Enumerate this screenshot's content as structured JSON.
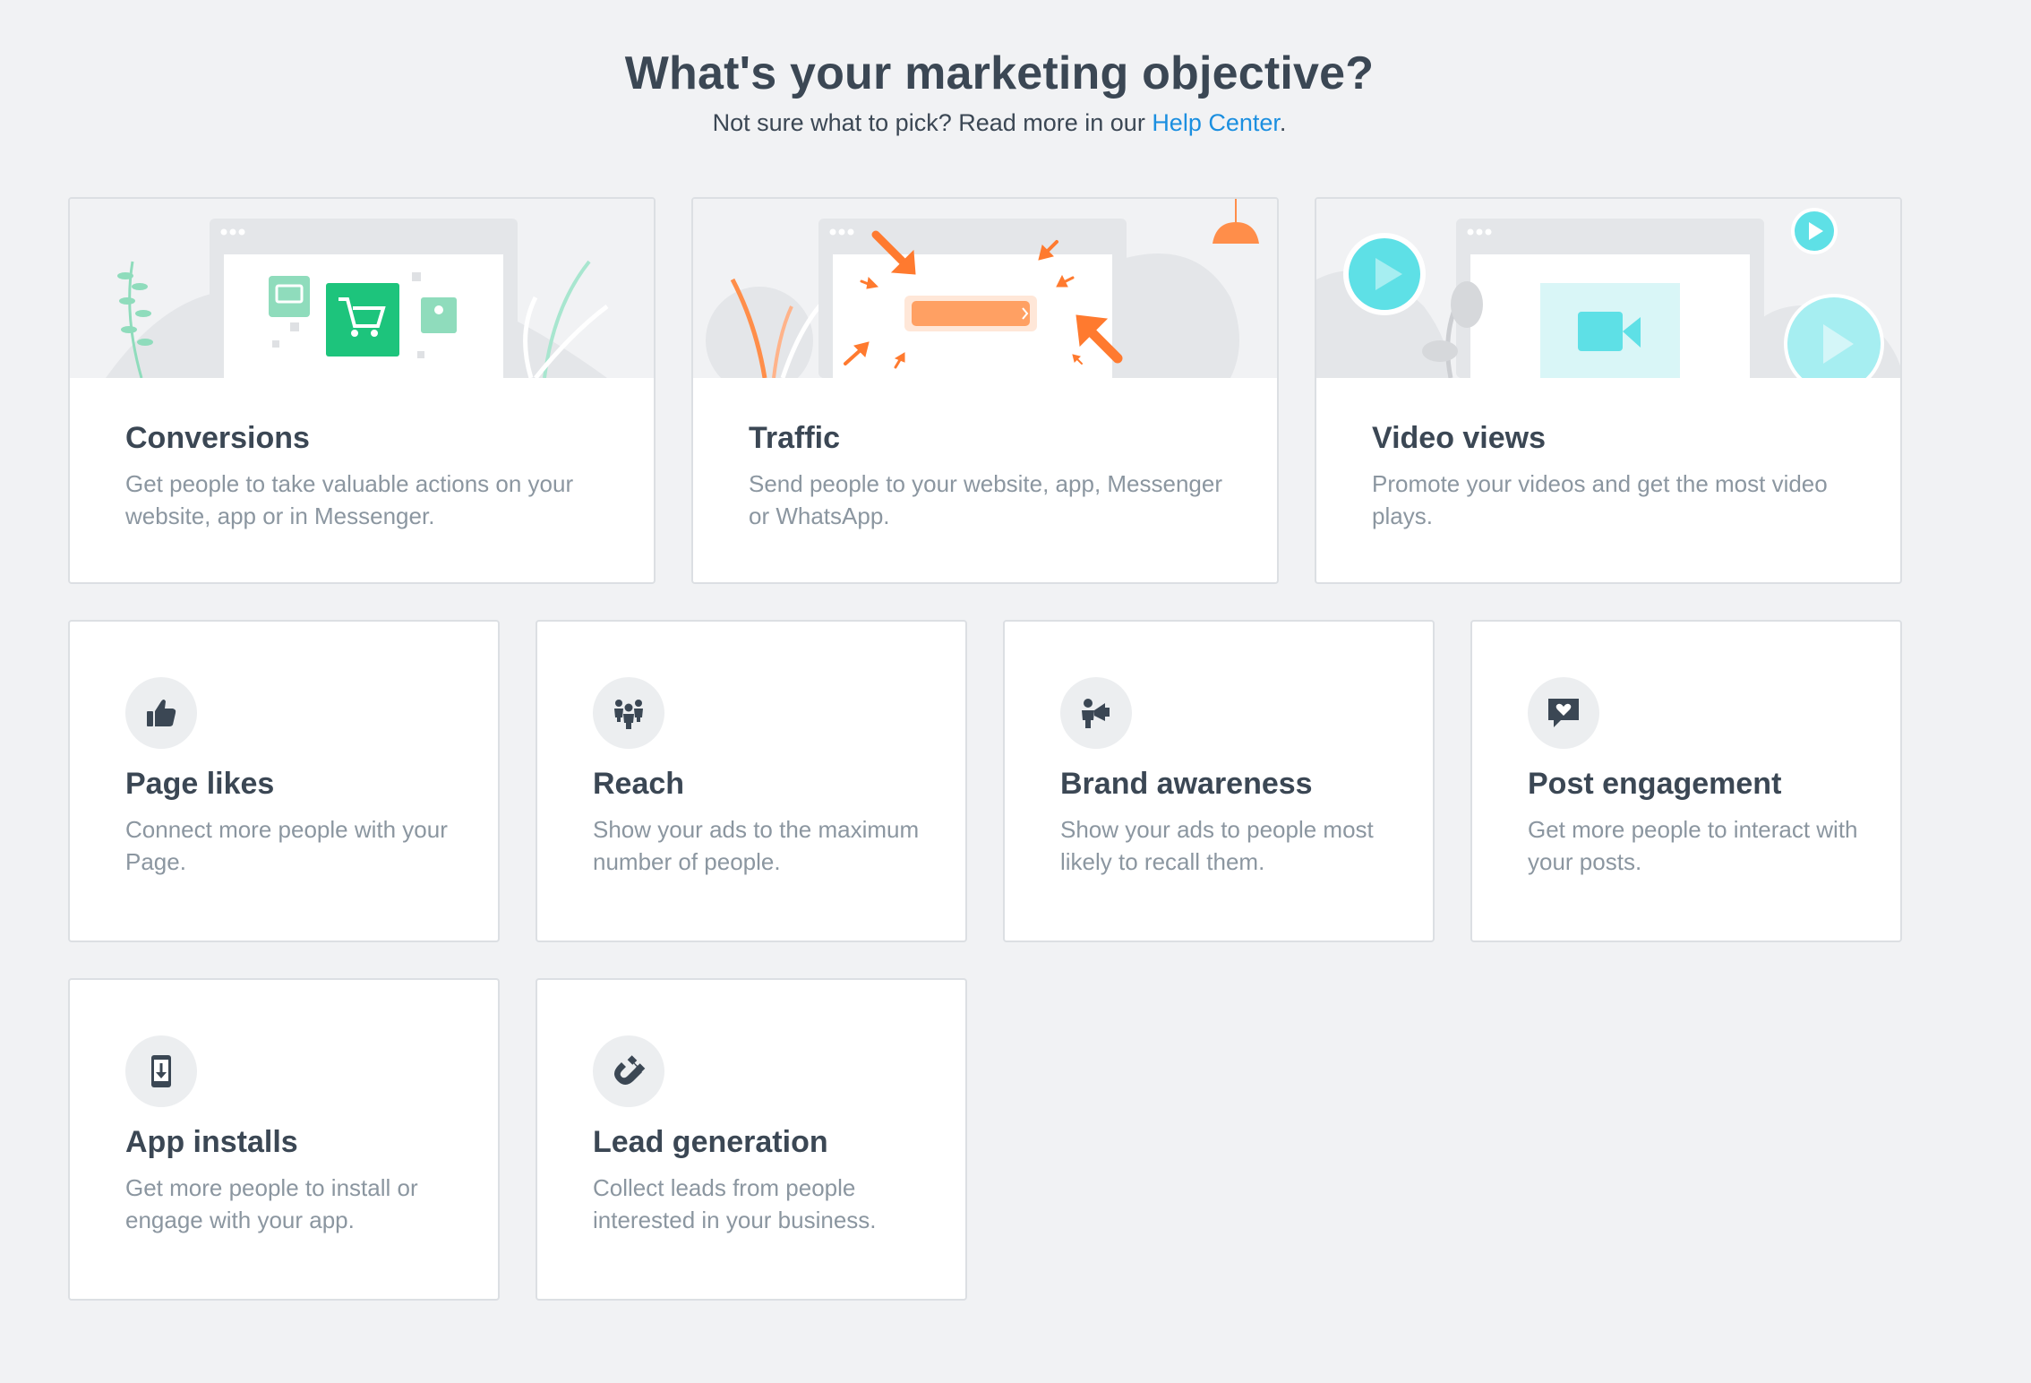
{
  "header": {
    "title": "What's your marketing objective?",
    "subtitle_prefix": "Not sure what to pick? Read more in our ",
    "help_link": "Help Center",
    "subtitle_suffix": "."
  },
  "colors": {
    "page_bg": "#f1f2f4",
    "text_dark": "#3b4754",
    "text_muted": "#8b96a0",
    "link": "#1b8fe0",
    "green": "#1dc47c",
    "orange": "#ff7a2f",
    "cyan": "#5ee0e6"
  },
  "objectives": {
    "conversions": {
      "title": "Conversions",
      "desc": "Get people to take valuable actions on your website, app or in Messenger.",
      "icon": "shopping-cart-illustration"
    },
    "traffic": {
      "title": "Traffic",
      "desc": "Send people to your website, app, Messenger or WhatsApp.",
      "icon": "arrows-to-button-illustration"
    },
    "video_views": {
      "title": "Video views",
      "desc": "Promote your videos and get the most video plays.",
      "icon": "video-play-illustration"
    },
    "page_likes": {
      "title": "Page likes",
      "desc": "Connect more people with your Page.",
      "icon": "thumbs-up-icon"
    },
    "reach": {
      "title": "Reach",
      "desc": "Show your ads to the maximum number of people.",
      "icon": "people-group-icon"
    },
    "brand_awareness": {
      "title": "Brand awareness",
      "desc": "Show your ads to people most likely to recall them.",
      "icon": "person-megaphone-icon"
    },
    "post_engagement": {
      "title": "Post engagement",
      "desc": "Get more people to interact with your posts.",
      "icon": "heart-speech-bubble-icon"
    },
    "app_installs": {
      "title": "App installs",
      "desc": "Get more people to install or engage with your app.",
      "icon": "phone-download-icon"
    },
    "lead_generation": {
      "title": "Lead generation",
      "desc": "Collect leads from people interested in your business.",
      "icon": "magnet-icon"
    }
  }
}
